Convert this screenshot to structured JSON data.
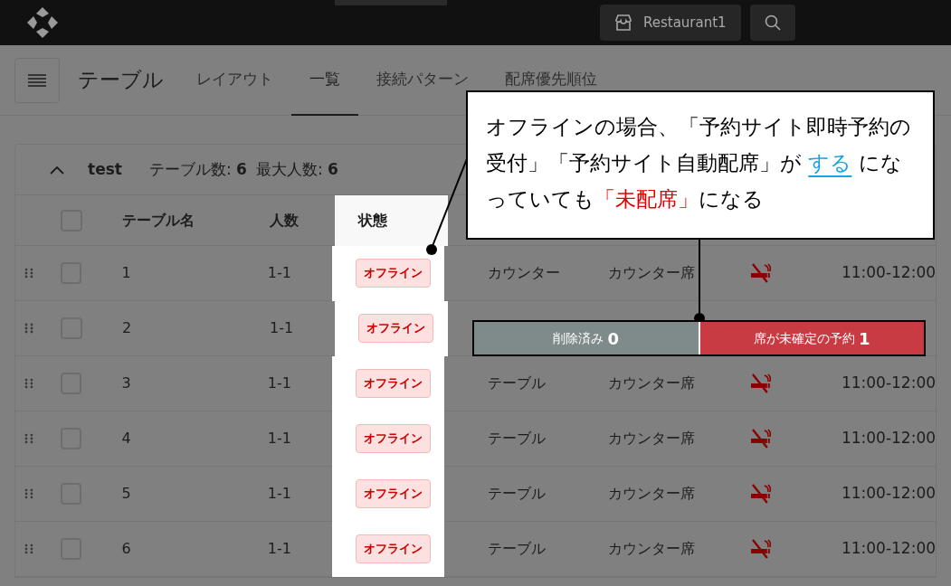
{
  "header": {
    "store_button": "Restaurant1"
  },
  "page": {
    "title": "テーブル",
    "tabs": [
      {
        "label": "レイアウト",
        "selected": false
      },
      {
        "label": "一覧",
        "selected": true
      },
      {
        "label": "接続パターン",
        "selected": false
      },
      {
        "label": "配席優先順位",
        "selected": false
      }
    ]
  },
  "group": {
    "name": "test",
    "expanded": true,
    "stats": [
      "テーブル数: **6**",
      "最大人数: **6**"
    ]
  },
  "table": {
    "all_checked": false,
    "columns": [
      "テーブル名",
      "人数",
      "状態"
    ],
    "rows": [
      {
        "checked": false,
        "name": "1",
        "capacity": "1-1",
        "status": "オフライン",
        "type": "カウンター",
        "seat": "カウンター席",
        "time": "11:00-12:00"
      },
      {
        "checked": false,
        "name": "2",
        "capacity": "1-1",
        "status": "オフライン"
      },
      {
        "checked": false,
        "name": "3",
        "capacity": "1-1",
        "status": "オフライン",
        "type": "テーブル",
        "seat": "カウンター席",
        "time": "11:00-12:00"
      },
      {
        "checked": false,
        "name": "4",
        "capacity": "1-1",
        "status": "オフライン",
        "type": "テーブル",
        "seat": "カウンター席",
        "time": "11:00-12:00"
      },
      {
        "checked": false,
        "name": "5",
        "capacity": "1-1",
        "status": "オフライン",
        "type": "テーブル",
        "seat": "カウンター席",
        "time": "11:00-12:00"
      },
      {
        "checked": false,
        "name": "6",
        "capacity": "1-1",
        "status": "オフライン",
        "type": "テーブル",
        "seat": "カウンター席",
        "time": "11:00-12:00"
      }
    ]
  },
  "callout": {
    "segments": [
      {
        "kind": "plain",
        "text": "オフラインの場合、「予約サイト即時予約の受付」「予約サイト自動配席」が "
      },
      {
        "kind": "link",
        "text": "する"
      },
      {
        "kind": "plain",
        "text": " になっていても"
      },
      {
        "kind": "alert",
        "text": "「未配席」"
      },
      {
        "kind": "plain",
        "text": "になる"
      }
    ]
  },
  "summary_bar": [
    {
      "label": "削除済み",
      "count": "0",
      "color": "#7f8a8a"
    },
    {
      "label": "席が未確定の予約",
      "count": "1",
      "color": "#c83b43"
    }
  ]
}
